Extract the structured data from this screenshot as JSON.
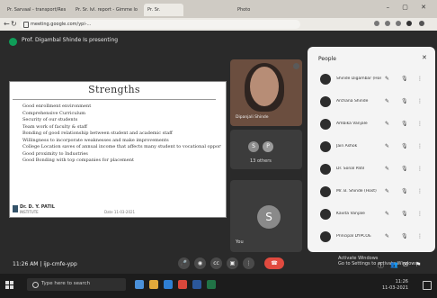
{
  "browser": {
    "tabs": [
      {
        "label": "Pr. Sarvaal - transport/Res",
        "active": false
      },
      {
        "label": "Pr. Sr. lvl. report - Gimme lo",
        "active": false
      },
      {
        "label": "Pr. Sr.",
        "active": true
      },
      {
        "label": "Photo",
        "active": false
      }
    ],
    "url": "meeting.google.com/ypi-..."
  },
  "meet": {
    "title": "Prof. Digambal Shinde Is presenting",
    "camera_name": "Dipanjali Shinde",
    "others_label": "13 others",
    "you_label": "You",
    "time_code": "11:26 AM | ijp-cmfe-ypp",
    "activate_windows": [
      "Activate Windows",
      "Go to Settings to activate Windows."
    ]
  },
  "slide": {
    "title": "Strengths",
    "bullets": [
      "Good enrollment environment",
      "Comprehensive Curriculum",
      "Security of our students",
      "Team work of faculty & staff",
      "Bonding of good relationship between student and academic staff",
      "Willingness to incorporate weaknesses and make improvements",
      "College Location saves of annual income that affects many student to vocational opportunities",
      "Good proximity to Industries",
      "Good Bonding with top companies for placement"
    ],
    "footer_name": "Dr. D. Y. PATIL",
    "footer_sub": "INSTITUTE",
    "footer_date": "Date 11-03-2021"
  },
  "people": {
    "title": "People",
    "participants": [
      {
        "name": "Shinde Digambar (Host)"
      },
      {
        "name": "Archana Shinde"
      },
      {
        "name": "Ambika Vanjale"
      },
      {
        "name": "Jain Ashok"
      },
      {
        "name": "Dr. Sonal Patil"
      },
      {
        "name": "Mr. B. Shinde (Host)"
      },
      {
        "name": "Kavita Vanjale"
      },
      {
        "name": "Principal DYPCOE"
      }
    ]
  },
  "taskbar": {
    "search_placeholder": "Type here to search",
    "tray_time": "11:26",
    "tray_date": "11-03-2021"
  },
  "colors": {
    "meet_bg": "#2a2a2a",
    "end_call": "#e04a3f",
    "panel_bg": "#f4f4f4"
  }
}
